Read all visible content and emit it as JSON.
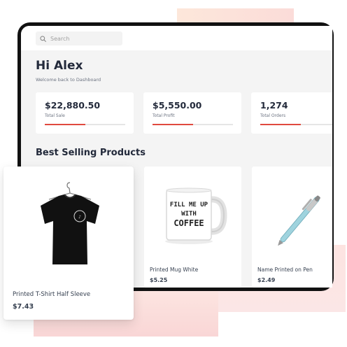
{
  "search": {
    "placeholder": "Search",
    "icon": "search-icon"
  },
  "header": {
    "greeting": "Hi Alex",
    "subtitle": "Welcome back to Dashboard"
  },
  "stats": [
    {
      "value": "$22,880.50",
      "label": "Total Sale",
      "progress": 0.5
    },
    {
      "value": "$5,550.00",
      "label": "Total Profit",
      "progress": 0.5
    },
    {
      "value": "1,274",
      "label": "Total Orders",
      "progress": 0.5
    }
  ],
  "best_selling": {
    "title": "Best Selling Products",
    "products": [
      {
        "name": "Printed T-Shirt Half Sleeve",
        "price": "$7.43",
        "image": "black-tshirt"
      },
      {
        "name": "Printed Mug White",
        "price": "$5.25",
        "image": "white-mug",
        "mug_text": [
          "FILL ME UP",
          "WITH",
          "COFFEE"
        ]
      },
      {
        "name": "Name Printed on Pen",
        "price": "$2.49",
        "image": "blue-pen"
      }
    ]
  },
  "colors": {
    "accent": "#e04a3f",
    "frame": "#111111",
    "background": "#f4f4f4",
    "heading": "#232a3b",
    "deco_peach": "#fde7da",
    "deco_pink": "#f9d6d6"
  }
}
